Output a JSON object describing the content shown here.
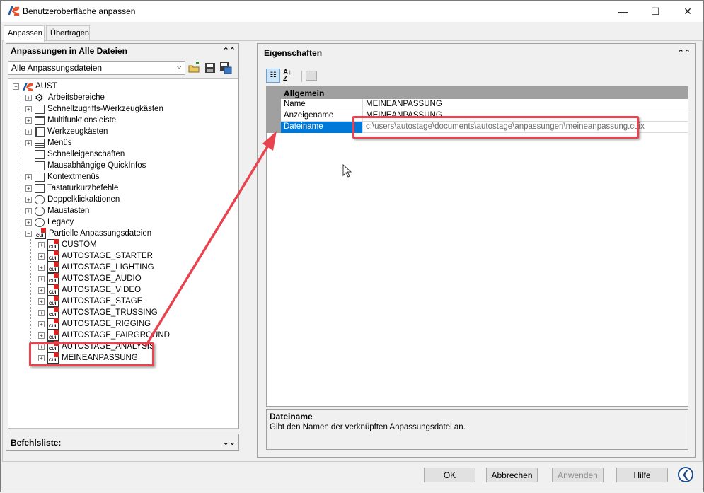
{
  "window": {
    "title": "Benutzeroberfläche anpassen",
    "minimize": "—",
    "maximize": "☐",
    "close": "✕"
  },
  "tabs": [
    {
      "label": "Anpassen",
      "active": true
    },
    {
      "label": "Übertragen",
      "active": false
    }
  ],
  "left_panel": {
    "header": "Anpassungen in Alle Dateien",
    "combo_value": "Alle Anpassungsdateien",
    "toolbar_icons": [
      "open-file-icon",
      "save-icon",
      "save-as-icon"
    ],
    "tree": {
      "root": "AUST",
      "items": [
        {
          "label": "Arbeitsbereiche",
          "icon": "gear-icon",
          "expandable": true
        },
        {
          "label": "Schnellzugriffs-Werkzeugkästen",
          "icon": "toolbar-icon",
          "expandable": true
        },
        {
          "label": "Multifunktionsleiste",
          "icon": "ribbon-icon",
          "expandable": true
        },
        {
          "label": "Werkzeugkästen",
          "icon": "toolbar-icon",
          "expandable": true
        },
        {
          "label": "Menüs",
          "icon": "menu-icon",
          "expandable": true
        },
        {
          "label": "Schnelleigenschaften",
          "icon": "properties-icon",
          "expandable": false
        },
        {
          "label": "Mausabhängige QuickInfos",
          "icon": "tooltip-icon",
          "expandable": false
        },
        {
          "label": "Kontextmenüs",
          "icon": "context-menu-icon",
          "expandable": true
        },
        {
          "label": "Tastaturkurzbefehle",
          "icon": "keyboard-icon",
          "expandable": true
        },
        {
          "label": "Doppelklickaktionen",
          "icon": "mouse-icon",
          "expandable": true
        },
        {
          "label": "Maustasten",
          "icon": "mouse-icon",
          "expandable": true
        },
        {
          "label": "Legacy",
          "icon": "clock-icon",
          "expandable": true
        },
        {
          "label": "Partielle Anpassungsdateien",
          "icon": "cui-icon",
          "expandable": true,
          "expanded": true
        }
      ],
      "partial_files": [
        "CUSTOM",
        "AUTOSTAGE_STARTER",
        "AUTOSTAGE_LIGHTING",
        "AUTOSTAGE_AUDIO",
        "AUTOSTAGE_VIDEO",
        "AUTOSTAGE_STAGE",
        "AUTOSTAGE_TRUSSING",
        "AUTOSTAGE_RIGGING",
        "AUTOSTAGE_FAIRGROUND",
        "AUTOSTAGE_ANALYSIS",
        "MEINEANPASSUNG"
      ],
      "cui_label": "CUI"
    }
  },
  "command_panel": {
    "header": "Befehlsliste:"
  },
  "right_panel": {
    "header": "Eigenschaften",
    "category": "Allgemein",
    "properties": [
      {
        "name": "Name",
        "value": "MEINEANPASSUNG"
      },
      {
        "name": "Anzeigename",
        "value": "MEINEANPASSUNG"
      },
      {
        "name": "Dateiname",
        "value": "c:\\users\\autostage\\documents\\autostage\\anpassungen\\meineanpassung.cuix"
      }
    ],
    "description_title": "Dateiname",
    "description_text": "Gibt den Namen der verknüpften Anpassungsdatei an."
  },
  "buttons": {
    "ok": "OK",
    "cancel": "Abbrechen",
    "apply": "Anwenden",
    "help": "Hilfe",
    "nav": "❮"
  },
  "colors": {
    "annotation": "#e8434e",
    "selection": "#0078d7",
    "category_bg": "#a0a0a0"
  }
}
